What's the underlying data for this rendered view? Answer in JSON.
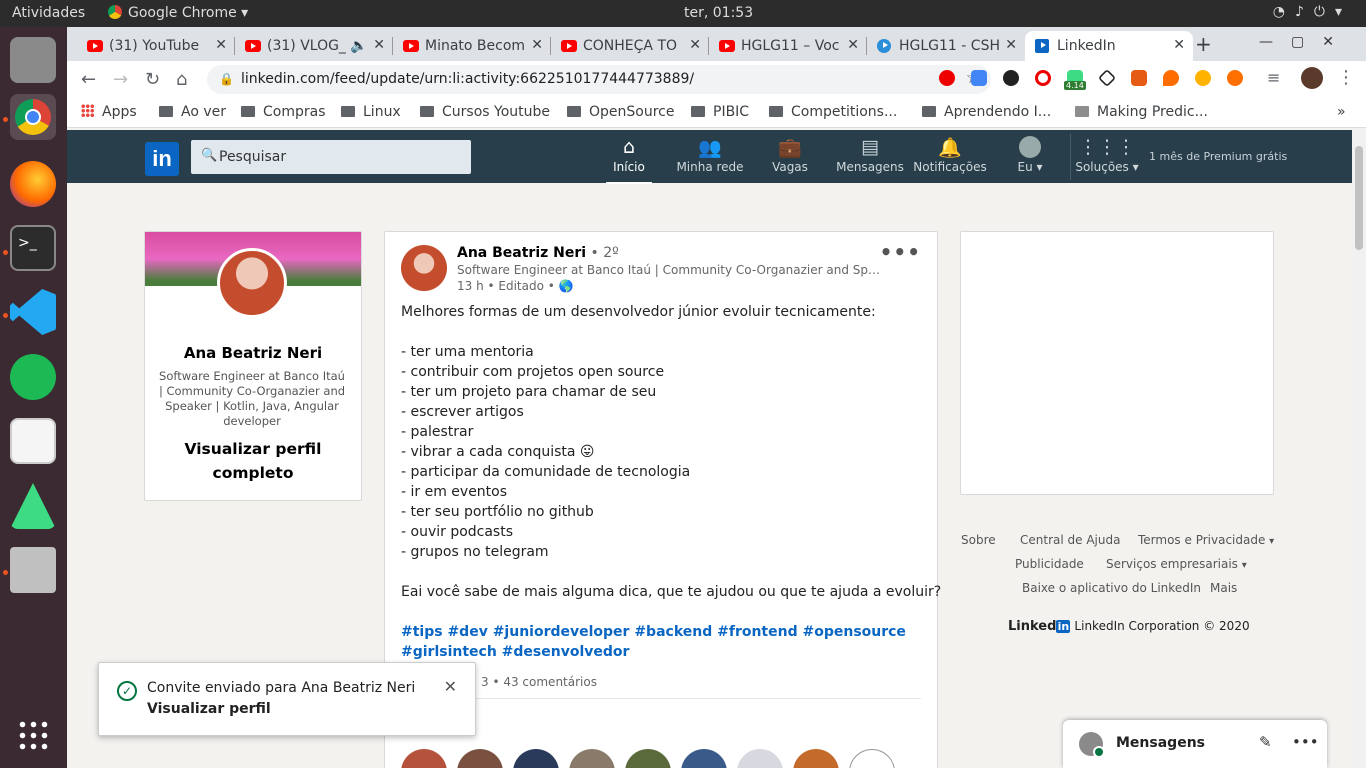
{
  "system": {
    "activities": "Atividades",
    "app_name": "Google Chrome",
    "clock": "ter, 01:53"
  },
  "tabs": [
    {
      "title": "(31) YouTube"
    },
    {
      "title": "(31) VLOG_"
    },
    {
      "title": "Minato Becom"
    },
    {
      "title": "CONHEÇA TO"
    },
    {
      "title": "HGLG11 – Voc"
    },
    {
      "title": "HGLG11 - CSH"
    },
    {
      "title": "LinkedIn"
    }
  ],
  "browser": {
    "url": "linkedin.com/feed/update/urn:li:activity:6622510177444773889/",
    "ext_badge": "4.14"
  },
  "bookmarks": [
    {
      "label": "Apps"
    },
    {
      "label": "Ao ver"
    },
    {
      "label": "Compras"
    },
    {
      "label": "Linux"
    },
    {
      "label": "Cursos Youtube"
    },
    {
      "label": "OpenSource"
    },
    {
      "label": "PIBIC"
    },
    {
      "label": "Competitions..."
    },
    {
      "label": "Aprendendo I..."
    },
    {
      "label": "Making Predic..."
    },
    {
      "label": "»"
    }
  ],
  "linkedin": {
    "logo": "in",
    "search_placeholder": "Pesquisar",
    "nav": [
      {
        "label": "Início"
      },
      {
        "label": "Minha rede"
      },
      {
        "label": "Vagas"
      },
      {
        "label": "Mensagens"
      },
      {
        "label": "Notificações"
      },
      {
        "label": "Eu"
      },
      {
        "label": "Soluções"
      }
    ],
    "premium": "1 mês de Premium grátis"
  },
  "profile": {
    "name": "Ana Beatriz Neri",
    "headline": "Software Engineer at Banco Itaú | Community Co-Organazier and Speaker | Kotlin, Java, Angular developer",
    "view_full": "Visualizar perfil completo"
  },
  "post": {
    "author": "Ana Beatriz Neri",
    "degree": " • 2º",
    "headline": "Software Engineer at Banco Itaú | Community Co-Organazier and Speaker | K...",
    "meta": "13 h • Editado • 🌎",
    "lines": [
      "Melhores formas de um desenvolvedor júnior evoluir tecnicamente:",
      "",
      "- ter uma mentoria",
      "- contribuir com projetos open source",
      "- ter um projeto para chamar de seu",
      "- escrever artigos",
      "- palestrar",
      "- vibrar a cada conquista 😛",
      "- participar da comunidade de tecnologia",
      "- ir em eventos",
      "- ter seu portfólio no github",
      "- ouvir podcasts",
      "- grupos no telegram",
      "",
      "Eai você sabe de mais alguma dica, que te ajudou ou que te ajuda a evoluir?"
    ],
    "hashtags": "#tips #dev #juniordeveloper #backend #frontend #opensource #girlsintech #desenvolvedor",
    "social": "3 • 43 comentários"
  },
  "footer": {
    "links": [
      "Sobre",
      "Central de Ajuda",
      "Termos e Privacidade",
      "Publicidade",
      "Serviços empresariais",
      "Baixe o aplicativo do LinkedIn",
      "Mais"
    ],
    "brand_word": "Linked",
    "brand_in": "in",
    "copyright": "LinkedIn Corporation © 2020"
  },
  "toast": {
    "message": "Convite enviado para Ana Beatriz Neri",
    "link": "Visualizar perfil"
  },
  "messaging": {
    "title": "Mensagens"
  }
}
